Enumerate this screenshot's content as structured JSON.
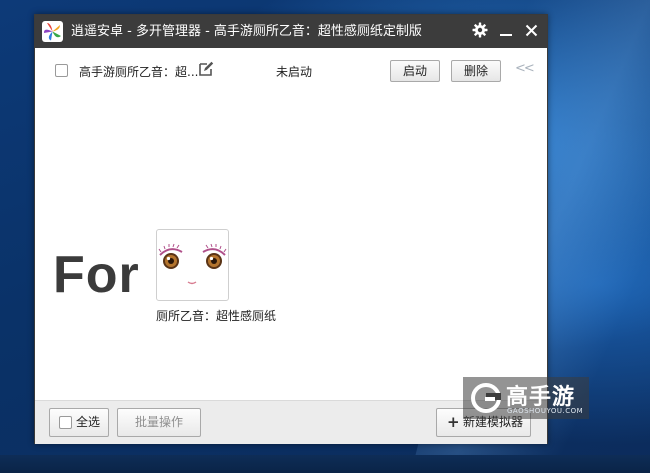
{
  "window": {
    "title": "逍遥安卓 - 多开管理器  - 高手游厕所乙音：超性感厕纸定制版"
  },
  "emulator_row": {
    "name": "高手游厕所乙音：超...",
    "status": "未启动",
    "start_label": "启动",
    "delete_label": "删除",
    "collapse_glyph": "<<"
  },
  "promo": {
    "for_text": "For",
    "game_caption": "厕所乙音：超性感厕纸"
  },
  "bottom": {
    "select_all_label": "全选",
    "batch_label": "批量操作",
    "new_emulator_label": "新建模拟器",
    "plus_glyph": "+"
  },
  "watermark": {
    "brand": "高手游",
    "url": "GAOSHOUYOU.COM"
  },
  "icons": {
    "settings": "gear-icon",
    "minimize": "minimize-icon",
    "close": "close-icon",
    "edit": "edit-icon",
    "collapse": "chevron-double-left-icon"
  },
  "colors": {
    "titlebar": "#3c3c3c",
    "window_bg": "#ffffff",
    "bottombar": "#ececec",
    "promo_text": "#3b3b3b"
  }
}
